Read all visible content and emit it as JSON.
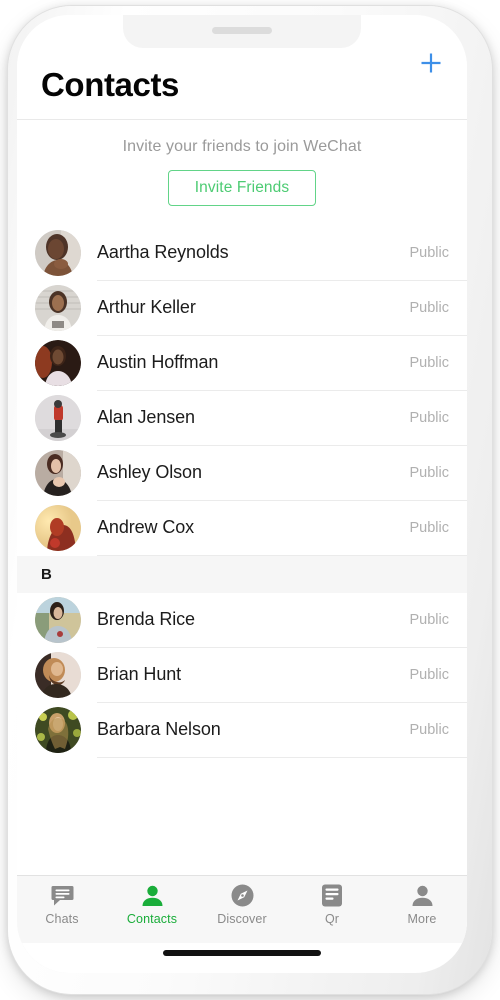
{
  "device": {
    "notch": "notch",
    "speaker": "speaker-slot",
    "home_indicator": "home-indicator"
  },
  "header": {
    "title": "Contacts",
    "add_icon": "plus-icon",
    "add_color": "#3d8fe8"
  },
  "invite": {
    "prompt": "Invite your friends to join WeChat",
    "button_label": "Invite Friends",
    "accent": "#4ccb72"
  },
  "list": {
    "sections": [
      {
        "letter": "",
        "show_header": false,
        "contacts": [
          {
            "name": "Aartha Reynolds",
            "tag": "Public",
            "avatar": "photo-woman-portrait"
          },
          {
            "name": "Arthur Keller",
            "tag": "Public",
            "avatar": "photo-person-white-shirt"
          },
          {
            "name": "Austin Hoffman",
            "tag": "Public",
            "avatar": "photo-person-dark-bg"
          },
          {
            "name": "Alan Jensen",
            "tag": "Public",
            "avatar": "photo-person-red-jacket"
          },
          {
            "name": "Ashley Olson",
            "tag": "Public",
            "avatar": "photo-woman-dark-hair"
          },
          {
            "name": "Andrew Cox",
            "tag": "Public",
            "avatar": "photo-silhouette-warm"
          }
        ]
      },
      {
        "letter": "B",
        "show_header": true,
        "contacts": [
          {
            "name": "Brenda Rice",
            "tag": "Public",
            "avatar": "photo-woman-outdoors"
          },
          {
            "name": "Brian Hunt",
            "tag": "Public",
            "avatar": "photo-man-beard"
          },
          {
            "name": "Barbara Nelson",
            "tag": "Public",
            "avatar": "photo-woman-field"
          }
        ]
      }
    ]
  },
  "tab_bar": {
    "active_color": "#1aad3a",
    "inactive_color": "#8a8a8a",
    "items": [
      {
        "label": "Chats",
        "icon": "chat-bubble-icon",
        "active": false
      },
      {
        "label": "Contacts",
        "icon": "person-icon",
        "active": true
      },
      {
        "label": "Discover",
        "icon": "compass-icon",
        "active": false
      },
      {
        "label": "Qr",
        "icon": "document-icon",
        "active": false
      },
      {
        "label": "More",
        "icon": "person-icon",
        "active": false
      }
    ]
  }
}
